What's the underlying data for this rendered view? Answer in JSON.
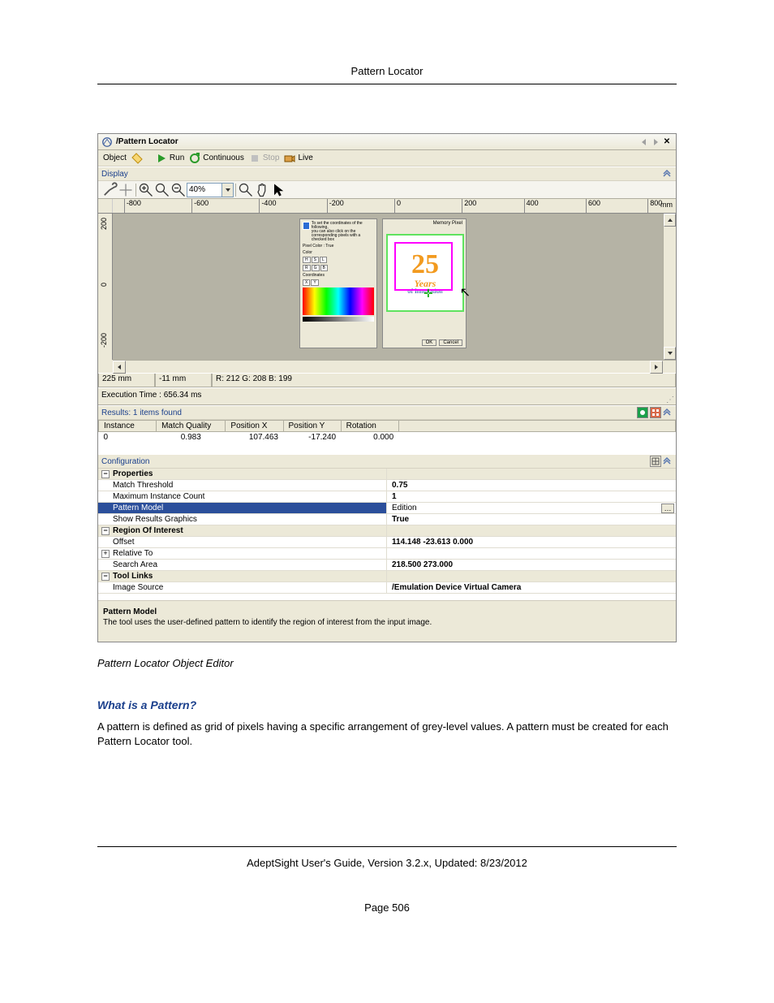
{
  "page": {
    "header_title": "Pattern Locator",
    "caption": "Pattern Locator Object Editor",
    "section_heading": "What is a Pattern?",
    "body_text": "A pattern is defined as grid of pixels having a specific arrangement of grey-level values. A pattern must be created for each Pattern Locator tool.",
    "footer_line": "AdeptSight User's Guide,  Version 3.2.x, Updated: 8/23/2012",
    "page_number": "Page 506"
  },
  "window": {
    "title": "/Pattern Locator",
    "toolbar": {
      "object": "Object",
      "run": "Run",
      "continuous": "Continuous",
      "stop": "Stop",
      "live": "Live"
    },
    "display_label": "Display",
    "zoom_value": "40%",
    "ruler": {
      "ticks": [
        "-800",
        "-600",
        "-400",
        "-200",
        "0",
        "200",
        "400",
        "600",
        "800"
      ],
      "unit": "mm",
      "vticks": [
        "200",
        "0",
        "-200"
      ]
    },
    "image_panel": {
      "logo_number": "25",
      "logo_years": "Years",
      "logo_sub": "of Innovation",
      "memory_label": "Memory Pixel",
      "btn_ok": "OK",
      "btn_cancel": "Cancel"
    },
    "status": {
      "x": "225 mm",
      "y": "-11 mm",
      "rgb": "R: 212 G: 208 B: 199"
    },
    "exec_time": "Execution Time : 656.34 ms",
    "results_label": "Results: 1 items found",
    "results_table": {
      "headers": [
        "Instance",
        "Match Quality",
        "Position X",
        "Position Y",
        "Rotation"
      ],
      "rows": [
        [
          "0",
          "0.983",
          "107.463",
          "-17.240",
          "0.000"
        ]
      ]
    },
    "configuration_label": "Configuration",
    "config": {
      "groups": [
        {
          "name": "Properties",
          "expanded": "−",
          "items": [
            {
              "k": "Match Threshold",
              "v": "0.75"
            },
            {
              "k": "Maximum Instance Count",
              "v": "1"
            },
            {
              "k": "Pattern Model",
              "v": "Edition",
              "selected": true
            },
            {
              "k": "Show Results Graphics",
              "v": "True"
            }
          ]
        },
        {
          "name": "Region Of Interest",
          "expanded": "−",
          "items": [
            {
              "k": "Offset",
              "v": "114.148 -23.613 0.000"
            },
            {
              "k": "Relative To",
              "v": "",
              "expander": "+"
            },
            {
              "k": "Search Area",
              "v": "218.500 273.000"
            }
          ]
        },
        {
          "name": "Tool Links",
          "expanded": "−",
          "items": [
            {
              "k": "Image Source",
              "v": "/Emulation Device Virtual Camera"
            }
          ]
        }
      ]
    },
    "help": {
      "title": "Pattern Model",
      "text": "The tool uses the user-defined pattern to identify the region of interest from the input image."
    }
  }
}
